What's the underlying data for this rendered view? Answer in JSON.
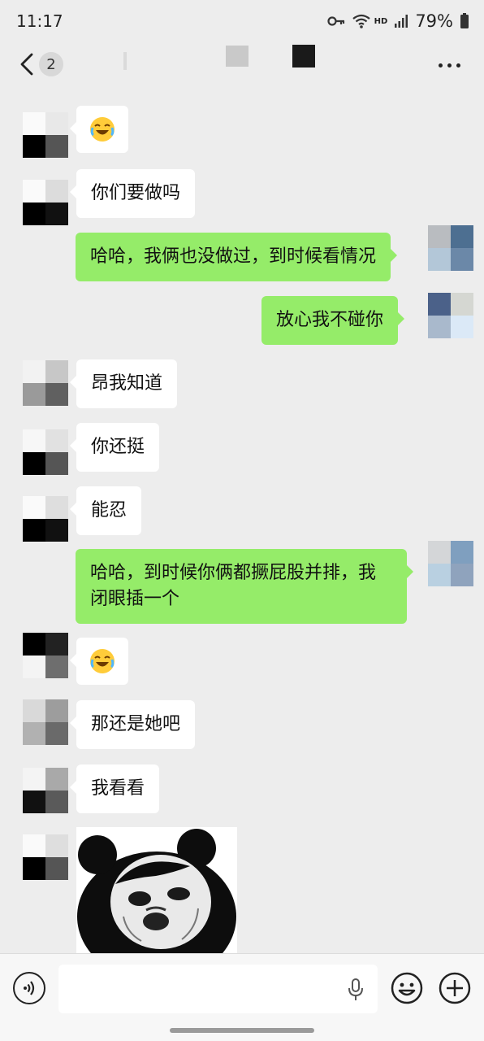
{
  "status": {
    "time": "11:17",
    "network_badge": "HD",
    "battery": "79%"
  },
  "nav": {
    "unread_count": "2"
  },
  "messages": [
    {
      "side": "left",
      "type": "emoji",
      "text": "😂"
    },
    {
      "side": "left",
      "type": "text",
      "text": "你们要做吗"
    },
    {
      "side": "right",
      "type": "text",
      "text": "哈哈，我俩也没做过，到时候看情况"
    },
    {
      "side": "right",
      "type": "text",
      "text": "放心我不碰你"
    },
    {
      "side": "left",
      "type": "text",
      "text": "昂我知道"
    },
    {
      "side": "left",
      "type": "text",
      "text": "你还挺"
    },
    {
      "side": "left",
      "type": "text",
      "text": "能忍"
    },
    {
      "side": "right",
      "type": "text",
      "text": "哈哈，到时候你俩都撅屁股并排，我闭眼插一个"
    },
    {
      "side": "left",
      "type": "emoji",
      "text": "😂"
    },
    {
      "side": "left",
      "type": "text",
      "text": "那还是她吧"
    },
    {
      "side": "left",
      "type": "text",
      "text": "我看看"
    },
    {
      "side": "left",
      "type": "sticker",
      "text": ""
    }
  ],
  "colors": {
    "background": "#ededed",
    "bubble_right": "#95ec69",
    "bubble_left": "#ffffff"
  },
  "icons": [
    "back-arrow-icon",
    "more-icon",
    "voice-icon",
    "microphone-icon",
    "emoji-icon",
    "plus-icon",
    "wifi-icon",
    "key-icon",
    "signal-icon",
    "battery-icon"
  ]
}
